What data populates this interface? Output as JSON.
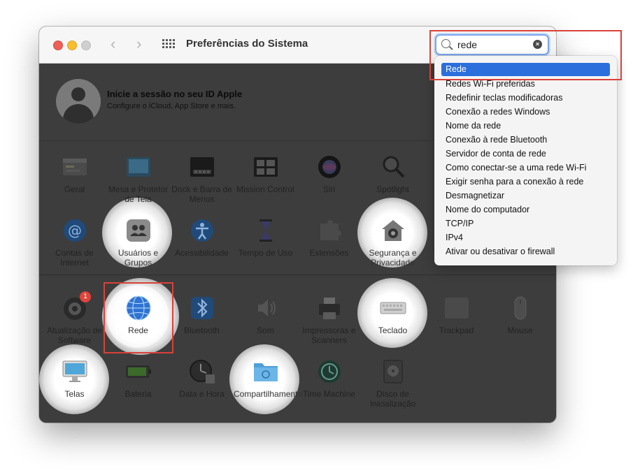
{
  "window": {
    "title": "Preferências do Sistema",
    "nav_back": "‹",
    "nav_forward": "›"
  },
  "search": {
    "value": "rede",
    "clear_icon": "×"
  },
  "account": {
    "title": "Inicie a sessão no seu ID Apple",
    "subtitle": "Configure o iCloud, App Store e mais."
  },
  "prefs": {
    "geral": "Geral",
    "mesa": "Mesa e Protetor de Tela",
    "dock": "Dock e Barra de Menus",
    "mission": "Mission Control",
    "siri": "Siri",
    "spotlight": "Spotlight",
    "contas": "Contas de Internet",
    "usuarios": "Usuários e Grupos",
    "acessibilidade": "Acessibilidade",
    "tempo": "Tempo de Uso",
    "extensoes": "Extensões",
    "seguranca": "Segurança e Privacidade",
    "atualizacao": "Atualização de Software",
    "rede": "Rede",
    "bluetooth": "Bluetooth",
    "som": "Som",
    "impressoras": "Impressoras e Scanners",
    "teclado": "Teclado",
    "trackpad": "Trackpad",
    "mouse": "Mouse",
    "telas": "Telas",
    "bateria": "Bateria",
    "data": "Data e Hora",
    "compartilhamento": "Compartilhamento",
    "time_machine": "Time Machine",
    "disco": "Disco de Inicialização"
  },
  "update_badge": "1",
  "dropdown": {
    "selected": "Rede",
    "items": [
      "Redes Wi-Fi preferidas",
      "Redefinir teclas modificadoras",
      "Conexão a redes Windows",
      "Nome da rede",
      "Conexão à rede Bluetooth",
      "Servidor de conta de rede",
      "Como conectar-se a uma rede Wi-Fi",
      "Exigir senha para a conexão à rede",
      "Desmagnetizar",
      "Nome do computador",
      "TCP/IP",
      "IPv4",
      "Ativar ou desativar o firewall"
    ]
  },
  "colors": {
    "accent": "#2b6fdc",
    "highlight_box": "#d9413a",
    "dim_overlay": "#3d3d3d"
  }
}
